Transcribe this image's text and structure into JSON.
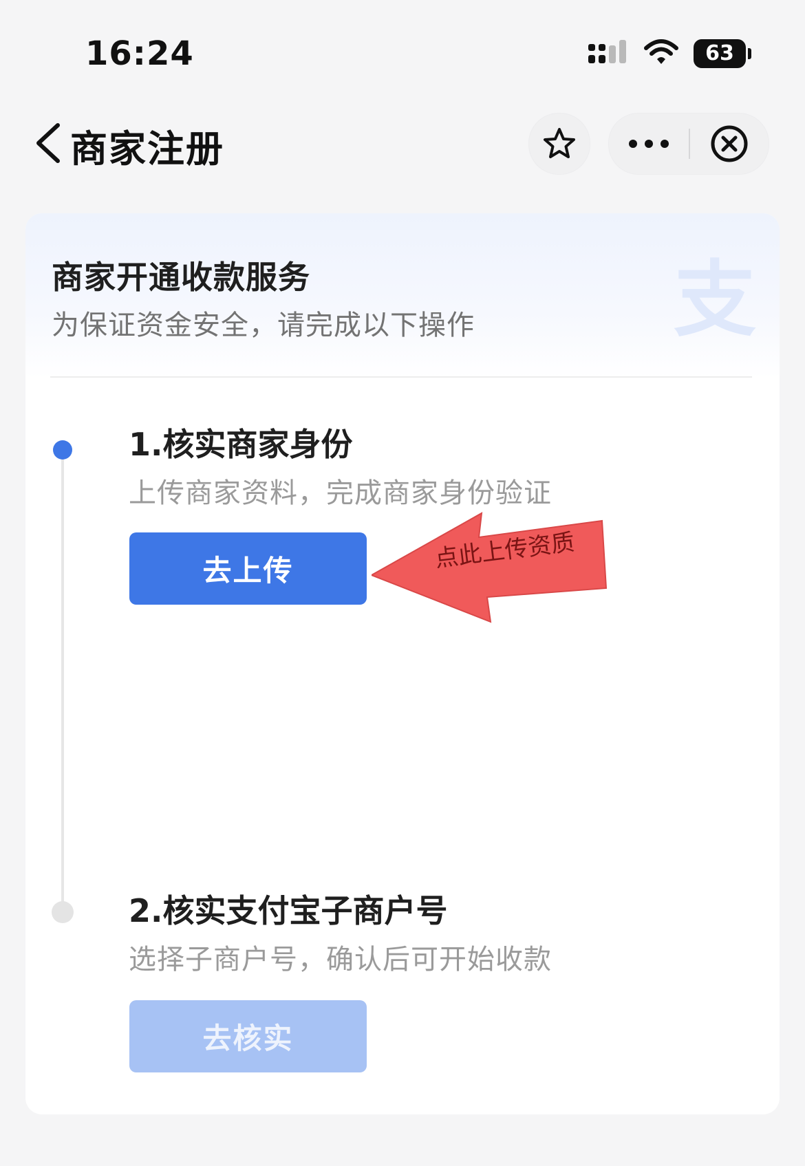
{
  "status_bar": {
    "time": "16:24",
    "battery": "63",
    "icons": [
      "cellular-signal-icon",
      "wifi-icon",
      "battery-icon"
    ]
  },
  "nav": {
    "back_icon": "chevron-left-icon",
    "title": "商家注册",
    "favorite_icon": "star-icon",
    "more_icon": "more-dots-icon",
    "close_icon": "close-circle-icon"
  },
  "card": {
    "title": "商家开通收款服务",
    "subtitle": "为保证资金安全，请完成以下操作",
    "watermark_logo": "支",
    "steps": [
      {
        "title": "1.核实商家身份",
        "desc": "上传商家资料，完成商家身份验证",
        "button": "去上传",
        "state": "active"
      },
      {
        "title": "2.核实支付宝子商户号",
        "desc": "选择子商户号，确认后可开始收款",
        "button": "去核实",
        "state": "disabled"
      }
    ]
  },
  "annotation": {
    "text": "点此上传资质",
    "color": "#f05a5a"
  },
  "colors": {
    "accent": "#3e77e6",
    "accent_disabled": "#a7c2f4",
    "page_bg": "#f5f5f6"
  }
}
